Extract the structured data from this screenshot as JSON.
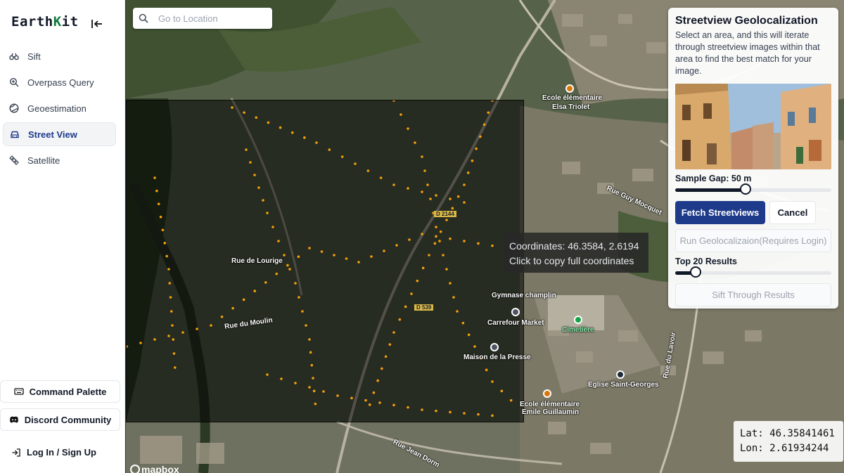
{
  "app": {
    "logo_prefix": "E",
    "logo_mid": "arth",
    "logo_k": "K",
    "logo_suffix": "it"
  },
  "nav": {
    "items": [
      {
        "label": "Sift",
        "icon": "binoculars-icon"
      },
      {
        "label": "Overpass Query",
        "icon": "search-plus-icon"
      },
      {
        "label": "Geoestimation",
        "icon": "globe-icon"
      },
      {
        "label": "Street View",
        "icon": "car-icon",
        "active": true
      },
      {
        "label": "Satellite",
        "icon": "satellite-icon"
      }
    ],
    "command_palette": "Command Palette",
    "discord": "Discord Community",
    "login": "Log In / Sign Up"
  },
  "search": {
    "placeholder": "Go to Location"
  },
  "tooltip": {
    "line1": "Coordinates: 46.3584, 2.6194",
    "line2": "Click to copy full coordinates"
  },
  "map_labels": {
    "ecole1_a": "Ecole élémentaire",
    "ecole1_b": "Elsa Triolet",
    "rue_guy_mocquet": "Rue Guy Mocquet",
    "d2144": "D 2144",
    "gymnase": "Gymnase champlin",
    "carrefour": "Carrefour Market",
    "cimetiere": "Cimetière",
    "maison_presse": "Maison de la Presse",
    "eglise": "Eglise Saint-Georges",
    "ecole2_a": "Ecole élémentaire",
    "ecole2_b": "Emile Guillaumin",
    "rue_du_moulin": "Rue du Moulin",
    "rue_de_lourige": "Rue de Lourige",
    "rue_jean_dorm": "Rue Jean Dorm",
    "d539": "D 539",
    "rue_du_lavoir": "Rue du Lavoir",
    "mapbox": "mapbox"
  },
  "coords": {
    "lat": "Lat: 46.35841461",
    "lon": "Lon: 2.61934244"
  },
  "panel": {
    "title": "Streetview Geolocalization",
    "description": "Select an area, and this will iterate through streetview images within that area to find the best match for your image.",
    "sample_gap_label": "Sample Gap: 50 m",
    "sample_gap_fraction": 0.45,
    "fetch_button": "Fetch Streetviews",
    "cancel_button": "Cancel",
    "run_button": "Run Geolocalizaion(Requires Login)",
    "top_results_label": "Top 20 Results",
    "top_results_fraction": 0.13,
    "sift_button": "Sift Through Results"
  },
  "colors": {
    "primary": "#1e3a8a",
    "logo_k": "#0d7a3a",
    "sample_point": "#f59e0b"
  }
}
